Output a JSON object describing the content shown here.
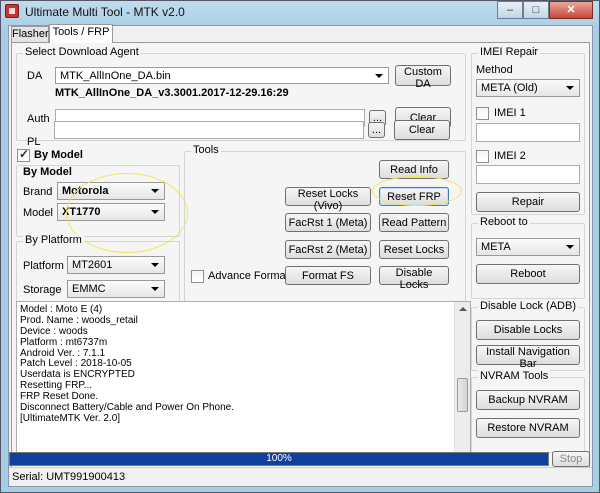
{
  "window": {
    "title": "Ultimate Multi Tool - MTK v2.0",
    "controls": {
      "minimize": "–",
      "maximize": "□",
      "close": "✕"
    }
  },
  "tabs": [
    {
      "label": "Flasher",
      "active": false
    },
    {
      "label": "Tools / FRP",
      "active": true
    }
  ],
  "download_agent": {
    "title": "Select Download Agent",
    "da_label": "DA",
    "da_value": "MTK_AllInOne_DA.bin",
    "da_version": "MTK_AllInOne_DA_v3.3001.2017-12-29.16:29",
    "custom_da_button": "Custom DA",
    "auth_label": "Auth",
    "pl_label": "PL",
    "browse_label": "...",
    "clear_label": "Clear"
  },
  "by_model": {
    "checkbox_label": "By Model",
    "checked": true,
    "title": "By Model",
    "brand_label": "Brand",
    "brand_value": "Motorola",
    "model_label": "Model",
    "model_value": "XT1770"
  },
  "by_platform": {
    "title": "By Platform",
    "platform_label": "Platform",
    "platform_value": "MT2601",
    "storage_label": "Storage",
    "storage_value": "EMMC"
  },
  "tools": {
    "title": "Tools",
    "read_info": "Read Info",
    "reset_locks_vivo": "Reset Locks (Vivo)",
    "reset_frp": "Reset FRP",
    "facrst1": "FacRst 1 (Meta)",
    "read_pattern": "Read Pattern",
    "facrst2": "FacRst 2 (Meta)",
    "reset_locks": "Reset Locks",
    "advance_format": "Advance Format",
    "format_fs": "Format FS",
    "disable_locks": "Disable Locks"
  },
  "imei_repair": {
    "title": "IMEI Repair",
    "method_label": "Method",
    "method_value": "META (Old)",
    "imei1_label": "IMEI 1",
    "imei2_label": "IMEI 2",
    "repair_button": "Repair"
  },
  "reboot": {
    "title": "Reboot to",
    "value": "META",
    "button": "Reboot"
  },
  "disable_lock": {
    "title": "Disable Lock (ADB)",
    "disable_button": "Disable Locks",
    "install_button": "Install Navigation Bar"
  },
  "nvram": {
    "title": "NVRAM Tools",
    "backup_button": "Backup NVRAM",
    "restore_button": "Restore NVRAM"
  },
  "log": [
    "Model : Moto E (4)",
    "Prod. Name : woods_retail",
    "Device : woods",
    "Platform : mt6737m",
    "Android Ver. : 7.1.1",
    "Patch Level : 2018-10-05",
    "Userdata is ENCRYPTED",
    "Resetting FRP...",
    "FRP Reset Done.",
    "Disconnect Battery/Cable and Power On Phone.",
    "[UltimateMTK Ver. 2.0]"
  ],
  "progress": {
    "percent": 100,
    "label": "100%"
  },
  "stop_button": "Stop",
  "status": {
    "serial": "Serial: UMT991900413"
  },
  "colors": {
    "accent_highlight": "#f2e55c",
    "progress": "#10409e",
    "titlebar": "#bfdcef"
  }
}
